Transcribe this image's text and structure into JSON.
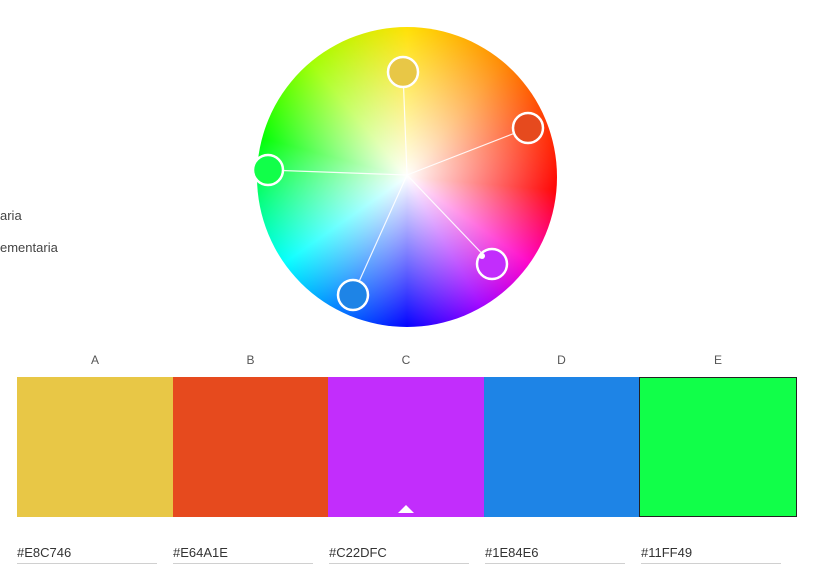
{
  "rules": {
    "items": [
      {
        "label": "aria"
      },
      {
        "label": "ementaria"
      }
    ]
  },
  "wheel": {
    "handles": [
      {
        "name": "handle-a",
        "color": "#E8C746"
      },
      {
        "name": "handle-b",
        "color": "#E64A1E"
      },
      {
        "name": "handle-c",
        "color": "#C22DFC"
      },
      {
        "name": "handle-d",
        "color": "#1E84E6"
      },
      {
        "name": "handle-e",
        "color": "#11FF49"
      }
    ]
  },
  "palette": {
    "columns": [
      {
        "label": "A",
        "color": "#E8C746",
        "hex": "#E8C746",
        "selected": false
      },
      {
        "label": "B",
        "color": "#E64A1E",
        "hex": "#E64A1E",
        "selected": false
      },
      {
        "label": "C",
        "color": "#C22DFC",
        "hex": "#C22DFC",
        "selected": true
      },
      {
        "label": "D",
        "color": "#1E84E6",
        "hex": "#1E84E6",
        "selected": false
      },
      {
        "label": "E",
        "color": "#11FF49",
        "hex": "#11FF49",
        "selected": false
      }
    ]
  }
}
